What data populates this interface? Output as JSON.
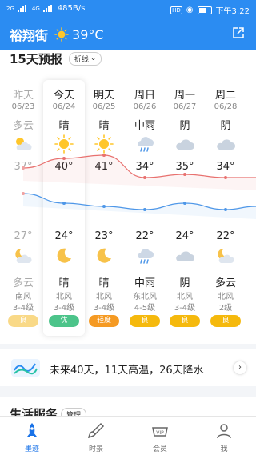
{
  "status": {
    "sim1": "2G",
    "sim2": "4G",
    "speed": "485B/s",
    "battery": "",
    "time": "下午3:22"
  },
  "header": {
    "city": "裕翔街",
    "temp": "39°C"
  },
  "forecast": {
    "title": "15天预报",
    "mode": "折线",
    "days": [
      {
        "day": "昨天",
        "date": "06/23",
        "weather_day": "多云",
        "icon_day": "partly-cloudy-icon",
        "high": "37°",
        "low": "27°",
        "icon_night": "cloudy-moon-icon",
        "weather_night": "多云",
        "wind": "南风",
        "level": "3-4级",
        "aqi": "良",
        "aqi_color": "#f9d987",
        "high_val": 37,
        "low_val": 27
      },
      {
        "day": "今天",
        "date": "06/24",
        "weather_day": "晴",
        "icon_day": "sun-icon",
        "high": "40°",
        "low": "24°",
        "icon_night": "moon-icon",
        "weather_night": "晴",
        "wind": "北风",
        "level": "3-4级",
        "aqi": "优",
        "aqi_color": "#4cc48a",
        "high_val": 40,
        "low_val": 24
      },
      {
        "day": "明天",
        "date": "06/25",
        "weather_day": "晴",
        "icon_day": "sun-icon",
        "high": "41°",
        "low": "23°",
        "icon_night": "moon-icon",
        "weather_night": "晴",
        "wind": "北风",
        "level": "3-4级",
        "aqi": "轻度",
        "aqi_color": "#f59a23",
        "high_val": 41,
        "low_val": 23
      },
      {
        "day": "周日",
        "date": "06/26",
        "weather_day": "中雨",
        "icon_day": "rain-icon",
        "high": "34°",
        "low": "22°",
        "icon_night": "rain-icon",
        "weather_night": "中雨",
        "wind": "东北风",
        "level": "4-5级",
        "aqi": "良",
        "aqi_color": "#f5b90d",
        "high_val": 34,
        "low_val": 22
      },
      {
        "day": "周一",
        "date": "06/27",
        "weather_day": "阴",
        "icon_day": "overcast-icon",
        "high": "35°",
        "low": "24°",
        "icon_night": "overcast-icon",
        "weather_night": "阴",
        "wind": "北风",
        "level": "3-4级",
        "aqi": "良",
        "aqi_color": "#f5b90d",
        "high_val": 35,
        "low_val": 24
      },
      {
        "day": "周二",
        "date": "06/28",
        "weather_day": "阴",
        "icon_day": "overcast-icon",
        "high": "34°",
        "low": "22°",
        "icon_night": "cloudy-moon-icon",
        "weather_night": "多云",
        "wind": "北风",
        "level": "2级",
        "aqi": "良",
        "aqi_color": "#f5b90d",
        "high_val": 34,
        "low_val": 22
      }
    ]
  },
  "promo": {
    "text": "未来40天，11天高温，26天降水"
  },
  "life": {
    "title": "生活服务",
    "manage": "管理"
  },
  "tabs": [
    {
      "label": "墨迹",
      "icon": "rocket-icon"
    },
    {
      "label": "时景",
      "icon": "brush-icon"
    },
    {
      "label": "会员",
      "icon": "vip-icon"
    },
    {
      "label": "我",
      "icon": "user-icon"
    }
  ],
  "colors": {
    "primary": "#2b8cf2",
    "high_line": "#e8716f",
    "low_line": "#4e97e8"
  }
}
